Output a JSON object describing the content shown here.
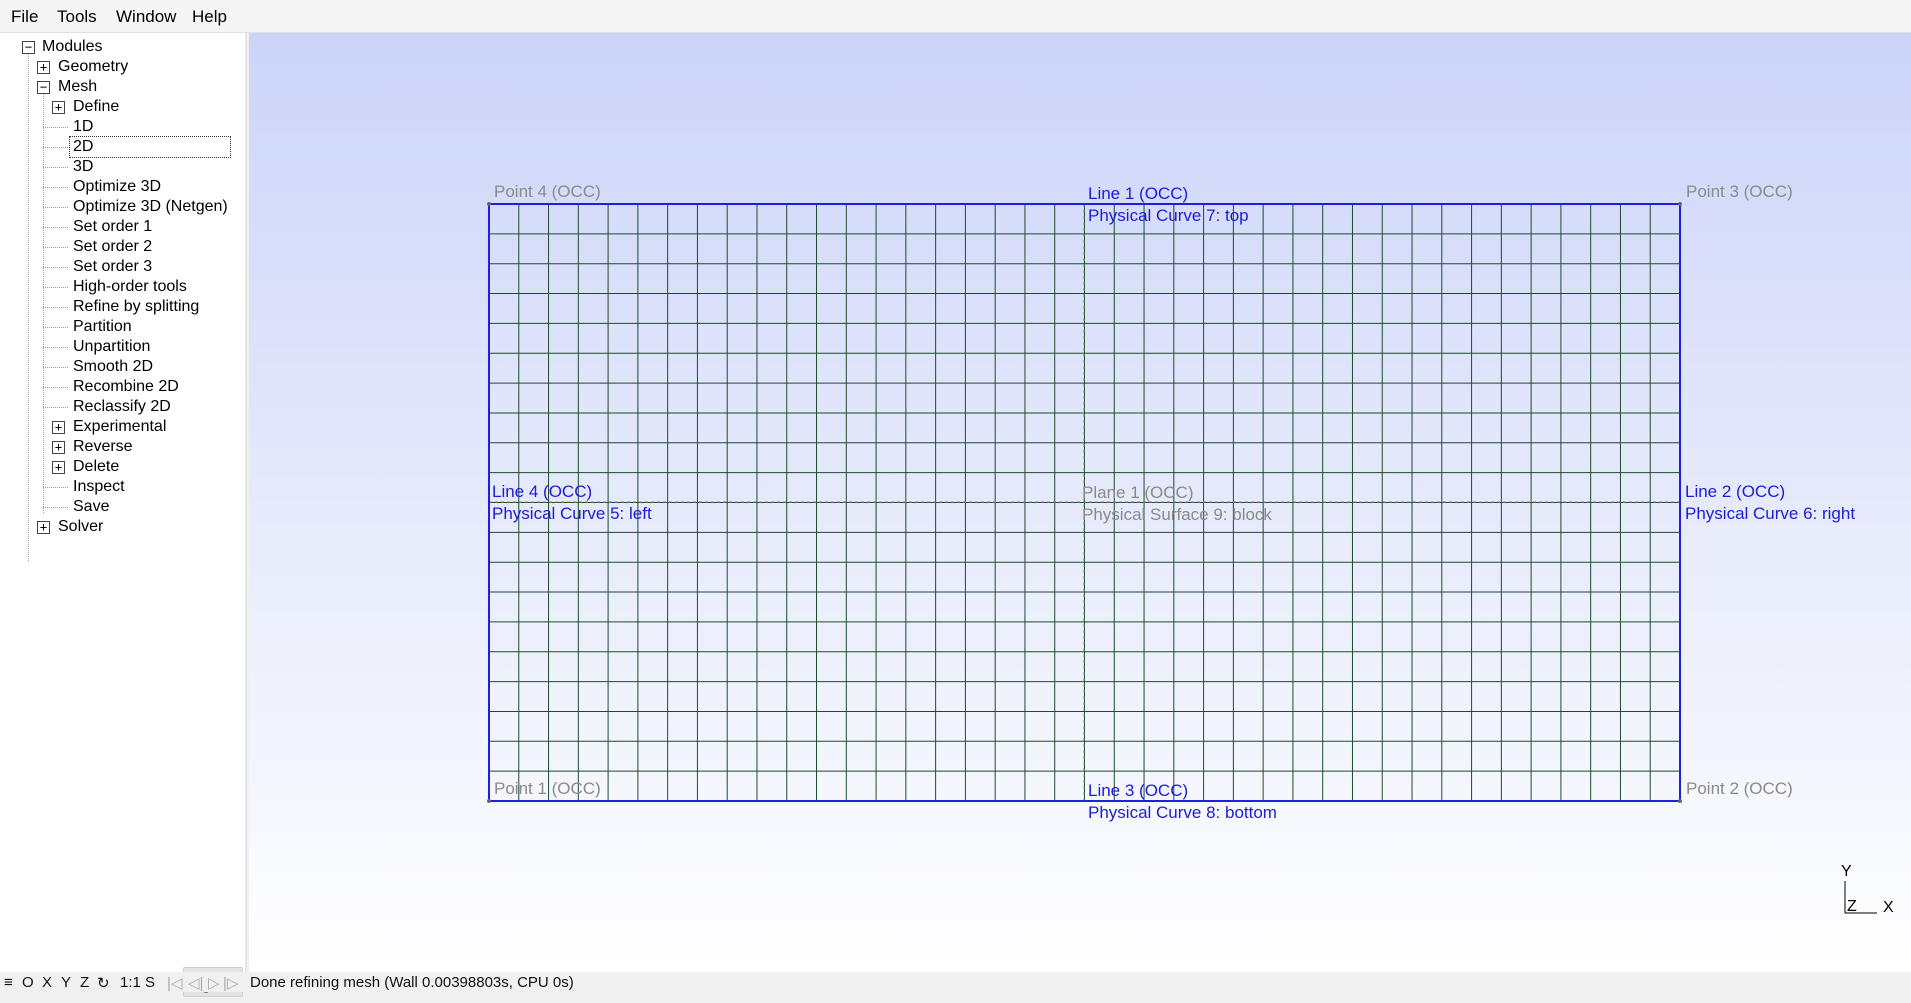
{
  "menu": [
    {
      "label": "File"
    },
    {
      "label": "Tools"
    },
    {
      "label": "Window"
    },
    {
      "label": "Help"
    }
  ],
  "tree": {
    "root": "Modules",
    "geometry": "Geometry",
    "mesh": "Mesh",
    "mesh_items": [
      "Define",
      "1D",
      "2D",
      "3D",
      "Optimize 3D",
      "Optimize 3D (Netgen)",
      "Set order 1",
      "Set order 2",
      "Set order 3",
      "High-order tools",
      "Refine by splitting",
      "Partition",
      "Unpartition",
      "Smooth 2D",
      "Recombine 2D",
      "Reclassify 2D",
      "Experimental",
      "Reverse",
      "Delete",
      "Inspect",
      "Save"
    ],
    "solver": "Solver",
    "selected": "2D"
  },
  "viewport": {
    "labels": {
      "point4": "Point 4 (OCC)",
      "point3": "Point 3 (OCC)",
      "point1": "Point 1 (OCC)",
      "point2": "Point 2 (OCC)",
      "line1": "Line 1 (OCC)",
      "line1_phys": "Physical Curve 7: top",
      "line2": "Line 2 (OCC)",
      "line2_phys": "Physical Curve 6: right",
      "line3": "Line 3 (OCC)",
      "line3_phys": "Physical Curve 8: bottom",
      "line4": "Line 4 (OCC)",
      "line4_phys": "Physical Curve 5: left",
      "plane1": "Plane 1 (OCC)",
      "plane1_phys": "Physical Surface 9: block"
    },
    "axes": {
      "y": "Y",
      "z": "Z",
      "x": "X"
    },
    "mesh": {
      "cols": 40,
      "rows": 20,
      "line_color": "#1e4a2e",
      "boundary_color": "#1f1fe0"
    }
  },
  "statusbar": {
    "buttons": [
      "≡",
      "O",
      "X",
      "Y",
      "Z",
      "↻",
      "1:1",
      "S"
    ],
    "message": "Done refining mesh (Wall 0.00398803s, CPU 0s)"
  },
  "colors": {
    "label_gray": "#8a8a8a",
    "label_blue": "#1c1cd8",
    "viewport_top": "#ccd4fa",
    "viewport_bottom": "#ffffff"
  }
}
